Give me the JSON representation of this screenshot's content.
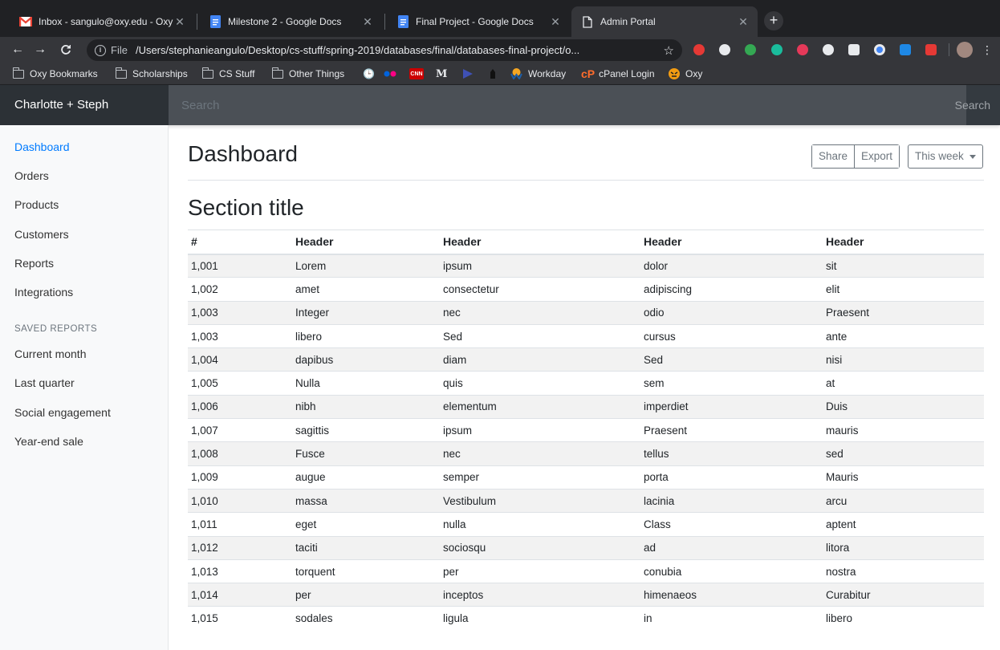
{
  "browser": {
    "tabs": [
      {
        "title": "Inbox - sangulo@oxy.edu - Oxy",
        "icon": "gmail-icon"
      },
      {
        "title": "Milestone 2 - Google Docs",
        "icon": "docs-icon"
      },
      {
        "title": "Final Project - Google Docs",
        "icon": "docs-icon"
      },
      {
        "title": "Admin Portal",
        "icon": "page-icon"
      }
    ],
    "address": {
      "scheme": "File",
      "url": "/Users/stephanieangulo/Desktop/cs-stuff/spring-2019/databases/final/databases-final-project/o..."
    },
    "bookmarks": [
      {
        "label": "Oxy Bookmarks"
      },
      {
        "label": "Scholarships"
      },
      {
        "label": "CS Stuff"
      },
      {
        "label": "Other Things"
      },
      {
        "label": "Workday"
      },
      {
        "label": "cPanel Login"
      },
      {
        "label": "Oxy"
      }
    ],
    "bookmark_letters": {
      "cnn": "CNN",
      "medium": "M"
    }
  },
  "navbar": {
    "brand": "Charlotte + Steph",
    "search_placeholder": "Search",
    "signout_label": "Search"
  },
  "sidebar": {
    "items": [
      {
        "label": "Dashboard"
      },
      {
        "label": "Orders"
      },
      {
        "label": "Products"
      },
      {
        "label": "Customers"
      },
      {
        "label": "Reports"
      },
      {
        "label": "Integrations"
      }
    ],
    "saved_heading": "Saved reports",
    "saved": [
      {
        "label": "Current month"
      },
      {
        "label": "Last quarter"
      },
      {
        "label": "Social engagement"
      },
      {
        "label": "Year-end sale"
      }
    ]
  },
  "main": {
    "title": "Dashboard",
    "share_label": "Share",
    "export_label": "Export",
    "range_label": "This week",
    "section_title": "Section title",
    "columns": [
      "#",
      "Header",
      "Header",
      "Header",
      "Header"
    ],
    "rows": [
      [
        "1,001",
        "Lorem",
        "ipsum",
        "dolor",
        "sit"
      ],
      [
        "1,002",
        "amet",
        "consectetur",
        "adipiscing",
        "elit"
      ],
      [
        "1,003",
        "Integer",
        "nec",
        "odio",
        "Praesent"
      ],
      [
        "1,003",
        "libero",
        "Sed",
        "cursus",
        "ante"
      ],
      [
        "1,004",
        "dapibus",
        "diam",
        "Sed",
        "nisi"
      ],
      [
        "1,005",
        "Nulla",
        "quis",
        "sem",
        "at"
      ],
      [
        "1,006",
        "nibh",
        "elementum",
        "imperdiet",
        "Duis"
      ],
      [
        "1,007",
        "sagittis",
        "ipsum",
        "Praesent",
        "mauris"
      ],
      [
        "1,008",
        "Fusce",
        "nec",
        "tellus",
        "sed"
      ],
      [
        "1,009",
        "augue",
        "semper",
        "porta",
        "Mauris"
      ],
      [
        "1,010",
        "massa",
        "Vestibulum",
        "lacinia",
        "arcu"
      ],
      [
        "1,011",
        "eget",
        "nulla",
        "Class",
        "aptent"
      ],
      [
        "1,012",
        "taciti",
        "sociosqu",
        "ad",
        "litora"
      ],
      [
        "1,013",
        "torquent",
        "per",
        "conubia",
        "nostra"
      ],
      [
        "1,014",
        "per",
        "inceptos",
        "himenaeos",
        "Curabitur"
      ],
      [
        "1,015",
        "sodales",
        "ligula",
        "in",
        "libero"
      ]
    ]
  },
  "colors": {
    "accent": "#007bff",
    "navbar": "#343a40",
    "sidebar": "#f8f9fa",
    "stripe": "#f2f2f2"
  }
}
